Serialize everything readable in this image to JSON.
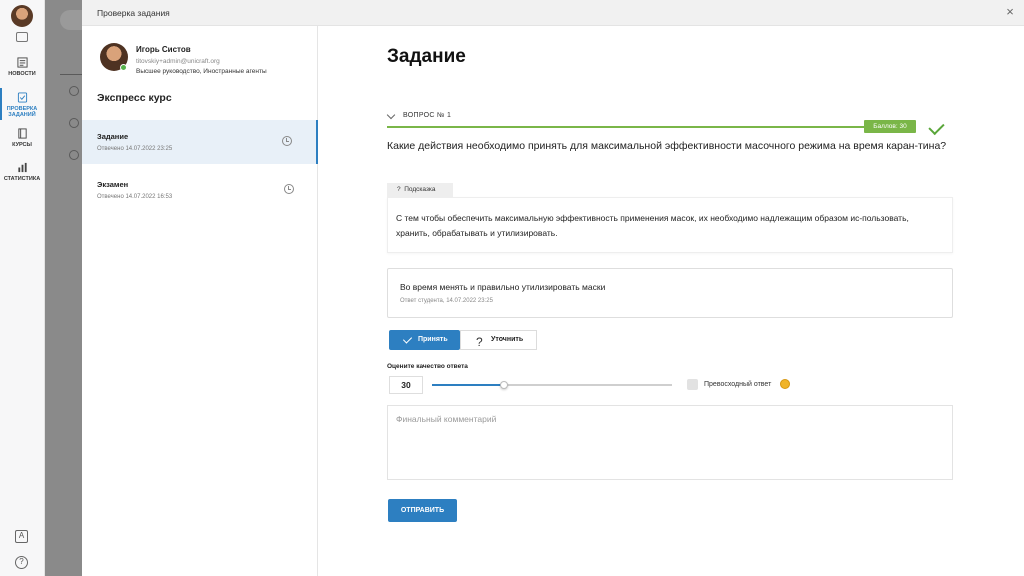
{
  "app_nav": {
    "items": [
      {
        "label": "НОВОСТИ",
        "icon": "newspaper-icon"
      },
      {
        "label": "ПРОВЕРКА ЗАДАНИЙ",
        "icon": "task-review-icon",
        "active": true
      },
      {
        "label": "КУРСЫ",
        "icon": "book-icon"
      },
      {
        "label": "СТАТИСТИКА",
        "icon": "bar-chart-icon"
      }
    ],
    "accent_color": "#2d7fc1"
  },
  "modal": {
    "title": "Проверка задания",
    "close_label": "×"
  },
  "student": {
    "name": "Игорь Систов",
    "email": "titovskiy+admin@unicraft.org",
    "role": "Высшее руководство, Иностранные агенты"
  },
  "course": {
    "title": "Экспресс курс",
    "tasks": [
      {
        "name": "Задание",
        "date": "Отвечено 14.07.2022 23:25",
        "active": true
      },
      {
        "name": "Экзамен",
        "date": "Отвечено 14.07.2022 16:53",
        "active": false
      }
    ]
  },
  "task": {
    "heading": "Задание",
    "question_label": "ВОПРОС № 1",
    "score_label": "Баллов: 30",
    "status_color": "#7ab648",
    "question_text": "Какие действия необходимо принять для максимальной эффективности масочного режима на время каран-тина?",
    "hint_label": "Подсказка",
    "hint_text": "С тем чтобы обеспечить максимальную эффективность применения масок, их необходимо надлежащим образом ис-пользовать, хранить, обрабатывать и утилизировать.",
    "answer_text": "Во время менять и правильно утилизировать маски",
    "answer_meta": "Ответ студента, 14.07.2022 23:25",
    "accept_label": "Принять",
    "clarify_label": "Уточнить",
    "rate_label": "Оцените качество ответа",
    "rate_value": "30",
    "rate_max": 100,
    "excellent_label": "Превосходный ответ",
    "comment_placeholder": "Финальный комментарий",
    "send_label": "ОТПРАВИТЬ"
  }
}
